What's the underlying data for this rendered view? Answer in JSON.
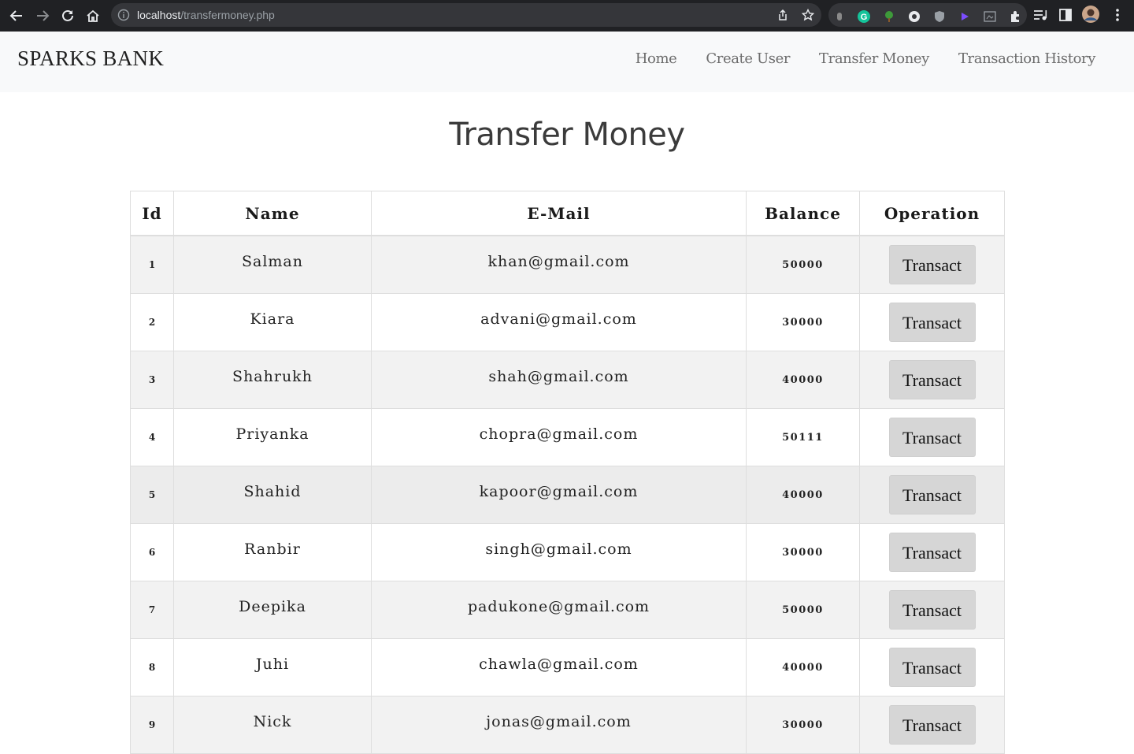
{
  "browser": {
    "url_host": "localhost",
    "url_path": "/transfermoney.php"
  },
  "navbar": {
    "brand": "SPARKS BANK",
    "links": [
      "Home",
      "Create User",
      "Transfer Money",
      "Transaction History"
    ]
  },
  "page": {
    "title": "Transfer Money"
  },
  "table": {
    "headers": [
      "Id",
      "Name",
      "E-Mail",
      "Balance",
      "Operation"
    ],
    "button_label": "Transact",
    "rows": [
      {
        "id": "1",
        "name": "Salman",
        "email": "khan@gmail.com",
        "balance": "50000"
      },
      {
        "id": "2",
        "name": "Kiara",
        "email": "advani@gmail.com",
        "balance": "30000"
      },
      {
        "id": "3",
        "name": "Shahrukh",
        "email": "shah@gmail.com",
        "balance": "40000"
      },
      {
        "id": "4",
        "name": "Priyanka",
        "email": "chopra@gmail.com",
        "balance": "50111"
      },
      {
        "id": "5",
        "name": "Shahid",
        "email": "kapoor@gmail.com",
        "balance": "40000"
      },
      {
        "id": "6",
        "name": "Ranbir",
        "email": "singh@gmail.com",
        "balance": "30000"
      },
      {
        "id": "7",
        "name": "Deepika",
        "email": "padukone@gmail.com",
        "balance": "50000"
      },
      {
        "id": "8",
        "name": "Juhi",
        "email": "chawla@gmail.com",
        "balance": "40000"
      },
      {
        "id": "9",
        "name": "Nick",
        "email": "jonas@gmail.com",
        "balance": "30000"
      }
    ]
  }
}
